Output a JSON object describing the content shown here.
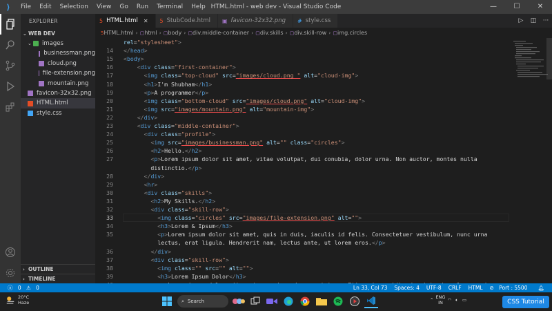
{
  "menu": [
    "File",
    "Edit",
    "Selection",
    "View",
    "Go",
    "Run",
    "Terminal",
    "Help"
  ],
  "window_title": "HTML.html - web dev - Visual Studio Code",
  "sidebar": {
    "header": "EXPLORER",
    "folder": "WEB DEV",
    "items": [
      {
        "label": "images",
        "kind": "folder"
      },
      {
        "label": "businessman.png",
        "kind": "png"
      },
      {
        "label": "cloud.png",
        "kind": "png"
      },
      {
        "label": "file-extension.png",
        "kind": "png"
      },
      {
        "label": "mountain.png",
        "kind": "png"
      },
      {
        "label": "favicon-32x32.png",
        "kind": "png"
      },
      {
        "label": "HTML.html",
        "kind": "html"
      },
      {
        "label": "style.css",
        "kind": "css"
      }
    ],
    "outline": "OUTLINE",
    "timeline": "TIMELINE"
  },
  "tabs": [
    {
      "label": "HTML.html",
      "icon": "html-file-icon",
      "active": true,
      "italic": false
    },
    {
      "label": "StubCode.html",
      "icon": "html-file-icon",
      "active": false,
      "italic": false
    },
    {
      "label": "favicon-32x32.png",
      "icon": "image-file-icon",
      "active": false,
      "italic": true
    },
    {
      "label": "style.css",
      "icon": "css-file-icon",
      "active": false,
      "italic": false
    }
  ],
  "breadcrumb": [
    "HTML.html",
    "html",
    "body",
    "div.middle-container",
    "div.skills",
    "div.skill-row",
    "img.circles"
  ],
  "editor": {
    "current_line": "33",
    "lines": [
      {
        "n": "",
        "segs": [
          [
            "a",
            "rel"
          ],
          [
            "tx",
            "="
          ],
          [
            "s",
            "\"stylesheet\""
          ],
          [
            "br",
            ">"
          ]
        ]
      },
      {
        "n": "14",
        "segs": [
          [
            "br",
            "</"
          ],
          [
            "t",
            "head"
          ],
          [
            "br",
            ">"
          ]
        ]
      },
      {
        "n": "15",
        "segs": [
          [
            "br",
            "<"
          ],
          [
            "t",
            "body"
          ],
          [
            "br",
            ">"
          ]
        ]
      },
      {
        "n": "16",
        "segs": [
          [
            "tx",
            "    "
          ],
          [
            "br",
            "<"
          ],
          [
            "t",
            "div"
          ],
          [
            "tx",
            " "
          ],
          [
            "a",
            "class"
          ],
          [
            "tx",
            "="
          ],
          [
            "s",
            "\"first-container\""
          ],
          [
            "br",
            ">"
          ]
        ]
      },
      {
        "n": "17",
        "segs": [
          [
            "tx",
            "      "
          ],
          [
            "br",
            "<"
          ],
          [
            "t",
            "img"
          ],
          [
            "tx",
            " "
          ],
          [
            "a",
            "class"
          ],
          [
            "tx",
            "="
          ],
          [
            "s",
            "\"top-cloud\""
          ],
          [
            "tx",
            " "
          ],
          [
            "a",
            "src"
          ],
          [
            "tx",
            "="
          ],
          [
            "su",
            "\"images/cloud.png \""
          ],
          [
            "tx",
            " "
          ],
          [
            "a",
            "alt"
          ],
          [
            "tx",
            "="
          ],
          [
            "s",
            "\"cloud-img\""
          ],
          [
            "br",
            ">"
          ]
        ]
      },
      {
        "n": "18",
        "segs": [
          [
            "tx",
            "      "
          ],
          [
            "br",
            "<"
          ],
          [
            "t",
            "h1"
          ],
          [
            "br",
            ">"
          ],
          [
            "tx",
            "I'm Shubham"
          ],
          [
            "br",
            "</"
          ],
          [
            "t",
            "h1"
          ],
          [
            "br",
            ">"
          ]
        ]
      },
      {
        "n": "19",
        "segs": [
          [
            "tx",
            "      "
          ],
          [
            "br",
            "<"
          ],
          [
            "t",
            "p"
          ],
          [
            "br",
            ">"
          ],
          [
            "tx",
            "A programmer"
          ],
          [
            "br",
            "</"
          ],
          [
            "t",
            "p"
          ],
          [
            "br",
            ">"
          ]
        ]
      },
      {
        "n": "20",
        "segs": [
          [
            "tx",
            "      "
          ],
          [
            "br",
            "<"
          ],
          [
            "t",
            "img"
          ],
          [
            "tx",
            " "
          ],
          [
            "a",
            "class"
          ],
          [
            "tx",
            "="
          ],
          [
            "s",
            "\"bottom-cloud\""
          ],
          [
            "tx",
            " "
          ],
          [
            "a",
            "src"
          ],
          [
            "tx",
            "="
          ],
          [
            "su",
            "\"images/cloud.png\""
          ],
          [
            "tx",
            " "
          ],
          [
            "a",
            "alt"
          ],
          [
            "tx",
            "="
          ],
          [
            "s",
            "\"cloud-img\""
          ],
          [
            "br",
            ">"
          ]
        ]
      },
      {
        "n": "21",
        "segs": [
          [
            "tx",
            "      "
          ],
          [
            "br",
            "<"
          ],
          [
            "t",
            "img"
          ],
          [
            "tx",
            " "
          ],
          [
            "a",
            "src"
          ],
          [
            "tx",
            "="
          ],
          [
            "su",
            "\"images/mountain.png\""
          ],
          [
            "tx",
            " "
          ],
          [
            "a",
            "alt"
          ],
          [
            "tx",
            "="
          ],
          [
            "s",
            "\"mountain-img\""
          ],
          [
            "br",
            ">"
          ]
        ]
      },
      {
        "n": "22",
        "segs": [
          [
            "tx",
            "    "
          ],
          [
            "br",
            "</"
          ],
          [
            "t",
            "div"
          ],
          [
            "br",
            ">"
          ]
        ]
      },
      {
        "n": "23",
        "segs": [
          [
            "tx",
            "    "
          ],
          [
            "br",
            "<"
          ],
          [
            "t",
            "div"
          ],
          [
            "tx",
            " "
          ],
          [
            "a",
            "class"
          ],
          [
            "tx",
            "="
          ],
          [
            "s",
            "\"middle-container\""
          ],
          [
            "br",
            ">"
          ]
        ]
      },
      {
        "n": "24",
        "segs": [
          [
            "tx",
            "      "
          ],
          [
            "br",
            "<"
          ],
          [
            "t",
            "div"
          ],
          [
            "tx",
            " "
          ],
          [
            "a",
            "class"
          ],
          [
            "tx",
            "="
          ],
          [
            "s",
            "\"profile\""
          ],
          [
            "br",
            ">"
          ]
        ]
      },
      {
        "n": "25",
        "segs": [
          [
            "tx",
            "        "
          ],
          [
            "br",
            "<"
          ],
          [
            "t",
            "img"
          ],
          [
            "tx",
            " "
          ],
          [
            "a",
            "src"
          ],
          [
            "tx",
            "="
          ],
          [
            "su",
            "\"images/businessman.png\""
          ],
          [
            "tx",
            " "
          ],
          [
            "a",
            "alt"
          ],
          [
            "tx",
            "="
          ],
          [
            "s",
            "\"\""
          ],
          [
            "tx",
            " "
          ],
          [
            "a",
            "class"
          ],
          [
            "tx",
            "="
          ],
          [
            "s",
            "\"circles\""
          ],
          [
            "br",
            ">"
          ]
        ]
      },
      {
        "n": "26",
        "segs": [
          [
            "tx",
            "        "
          ],
          [
            "br",
            "<"
          ],
          [
            "t",
            "h2"
          ],
          [
            "br",
            ">"
          ],
          [
            "tx",
            "Hello."
          ],
          [
            "br",
            "</"
          ],
          [
            "t",
            "h2"
          ],
          [
            "br",
            ">"
          ]
        ]
      },
      {
        "n": "27",
        "segs": [
          [
            "tx",
            "        "
          ],
          [
            "br",
            "<"
          ],
          [
            "t",
            "p"
          ],
          [
            "br",
            ">"
          ],
          [
            "tx",
            "Lorem ipsum dolor sit amet, vitae volutpat, dui conubia, dolor urna. Non auctor, montes nulla"
          ]
        ]
      },
      {
        "n": "",
        "segs": [
          [
            "tx",
            "        distinctio."
          ],
          [
            "br",
            "</"
          ],
          [
            "t",
            "p"
          ],
          [
            "br",
            ">"
          ]
        ]
      },
      {
        "n": "28",
        "segs": [
          [
            "tx",
            "      "
          ],
          [
            "br",
            "</"
          ],
          [
            "t",
            "div"
          ],
          [
            "br",
            ">"
          ]
        ]
      },
      {
        "n": "29",
        "segs": [
          [
            "tx",
            "      "
          ],
          [
            "br",
            "<"
          ],
          [
            "t",
            "hr"
          ],
          [
            "br",
            ">"
          ]
        ]
      },
      {
        "n": "30",
        "segs": [
          [
            "tx",
            "      "
          ],
          [
            "br",
            "<"
          ],
          [
            "t",
            "div"
          ],
          [
            "tx",
            " "
          ],
          [
            "a",
            "class"
          ],
          [
            "tx",
            "="
          ],
          [
            "s",
            "\"skills\""
          ],
          [
            "br",
            ">"
          ]
        ]
      },
      {
        "n": "31",
        "segs": [
          [
            "tx",
            "        "
          ],
          [
            "br",
            "<"
          ],
          [
            "t",
            "h2"
          ],
          [
            "br",
            ">"
          ],
          [
            "tx",
            "My Skills."
          ],
          [
            "br",
            "</"
          ],
          [
            "t",
            "h2"
          ],
          [
            "br",
            ">"
          ]
        ]
      },
      {
        "n": "32",
        "segs": [
          [
            "tx",
            "        "
          ],
          [
            "br",
            "<"
          ],
          [
            "t",
            "div"
          ],
          [
            "tx",
            " "
          ],
          [
            "a",
            "class"
          ],
          [
            "tx",
            "="
          ],
          [
            "s",
            "\"skill-row\""
          ],
          [
            "br",
            ">"
          ]
        ]
      },
      {
        "n": "33",
        "segs": [
          [
            "tx",
            "          "
          ],
          [
            "br",
            "<"
          ],
          [
            "t",
            "img"
          ],
          [
            "tx",
            " "
          ],
          [
            "a",
            "class"
          ],
          [
            "tx",
            "="
          ],
          [
            "s",
            "\"circles\""
          ],
          [
            "tx",
            " "
          ],
          [
            "a",
            "src"
          ],
          [
            "tx",
            "="
          ],
          [
            "su",
            "\"images/file-extension.png\""
          ],
          [
            "tx",
            " "
          ],
          [
            "a",
            "alt"
          ],
          [
            "tx",
            "="
          ],
          [
            "s",
            "\"\""
          ],
          [
            "br",
            ">"
          ]
        ]
      },
      {
        "n": "34",
        "segs": [
          [
            "tx",
            "          "
          ],
          [
            "br",
            "<"
          ],
          [
            "t",
            "h3"
          ],
          [
            "br",
            ">"
          ],
          [
            "tx",
            "Lorem & Ipsum"
          ],
          [
            "br",
            "</"
          ],
          [
            "t",
            "h3"
          ],
          [
            "br",
            ">"
          ]
        ]
      },
      {
        "n": "35",
        "segs": [
          [
            "tx",
            "          "
          ],
          [
            "br",
            "<"
          ],
          [
            "t",
            "p"
          ],
          [
            "br",
            ">"
          ],
          [
            "tx",
            "Lorem ipsum dolor sit amet, quis in duis, iaculis id felis. Consectetuer vestibulum, nunc urna"
          ]
        ]
      },
      {
        "n": "",
        "segs": [
          [
            "tx",
            "          lectus, erat ligula. Hendrerit nam, lectus ante, ut lorem eros."
          ],
          [
            "br",
            "</"
          ],
          [
            "t",
            "p"
          ],
          [
            "br",
            ">"
          ]
        ]
      },
      {
        "n": "36",
        "segs": [
          [
            "tx",
            "        "
          ],
          [
            "br",
            "</"
          ],
          [
            "t",
            "div"
          ],
          [
            "br",
            ">"
          ]
        ]
      },
      {
        "n": "37",
        "segs": [
          [
            "tx",
            "        "
          ],
          [
            "br",
            "<"
          ],
          [
            "t",
            "div"
          ],
          [
            "tx",
            " "
          ],
          [
            "a",
            "class"
          ],
          [
            "tx",
            "="
          ],
          [
            "s",
            "\"skill-row\""
          ],
          [
            "br",
            ">"
          ]
        ]
      },
      {
        "n": "38",
        "segs": [
          [
            "tx",
            "          "
          ],
          [
            "br",
            "<"
          ],
          [
            "t",
            "img"
          ],
          [
            "tx",
            " "
          ],
          [
            "a",
            "class"
          ],
          [
            "tx",
            "="
          ],
          [
            "s",
            "\"\""
          ],
          [
            "tx",
            " "
          ],
          [
            "a",
            "src"
          ],
          [
            "tx",
            "="
          ],
          [
            "s",
            "\"\""
          ],
          [
            "tx",
            " "
          ],
          [
            "a",
            "alt"
          ],
          [
            "tx",
            "="
          ],
          [
            "s",
            "\"\""
          ],
          [
            "br",
            ">"
          ]
        ]
      },
      {
        "n": "39",
        "segs": [
          [
            "tx",
            "          "
          ],
          [
            "br",
            "<"
          ],
          [
            "t",
            "h3"
          ],
          [
            "br",
            ">"
          ],
          [
            "tx",
            "Lorem Ipsum Dolor"
          ],
          [
            "br",
            "</"
          ],
          [
            "t",
            "h3"
          ],
          [
            "br",
            ">"
          ]
        ]
      },
      {
        "n": "40",
        "segs": [
          [
            "tx",
            "          "
          ],
          [
            "br",
            "<"
          ],
          [
            "t",
            "p"
          ],
          [
            "br",
            ">"
          ],
          [
            "tx",
            "Lorem ipsum dolor sit amet, mauris sed consectetuer. Etiam et eu, bibendum interdum, lacus quis"
          ]
        ]
      }
    ]
  },
  "status": {
    "errors": "0",
    "warnings": "0",
    "position": "Ln 33, Col 73",
    "spaces": "Spaces: 4",
    "encoding": "UTF-8",
    "eol": "CRLF",
    "language": "HTML",
    "port": "Port : 5500"
  },
  "taskbar": {
    "temp": "20°C",
    "weather": "Haze",
    "search": "Search",
    "lang": "ENG",
    "region": "IN"
  },
  "badge": "CSS Tutorial",
  "colors": {
    "accent": "#007acc",
    "tag": "#569cd6",
    "attr": "#9cdcfe",
    "string": "#ce9178"
  }
}
